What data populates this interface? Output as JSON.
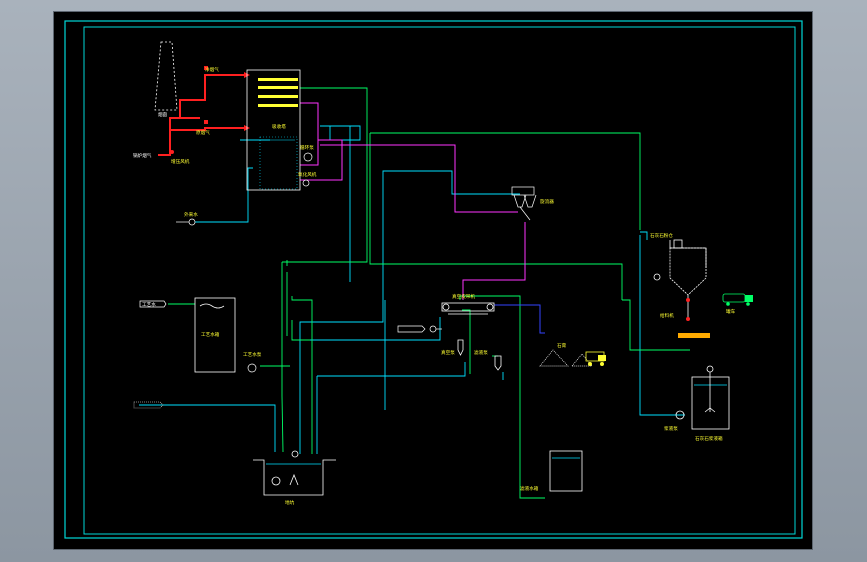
{
  "colors": {
    "background": "#000000",
    "frame": "#00d8d8",
    "flue_gas": "#ff2020",
    "water": "#00ff66",
    "slurry": "#00e0ff",
    "gypsum": "#ff33ff",
    "filtrate": "#3344ff",
    "equipment": "#ffffff",
    "label": "#ffff33"
  },
  "labels": {
    "chimney": "烟囱",
    "flue_gas_upper": "净烟气",
    "flue_gas_mid": "原烟气",
    "flue_gas_inlet": "锅炉烟气",
    "booster_fan": "增压风机",
    "absorber": "吸收塔",
    "circulation_pump": "循环泵",
    "oxidation_fan": "氧化风机",
    "cyclone": "旋流器",
    "process_water_tank": "工艺水箱",
    "process_water_pump": "工艺水泵",
    "process_water_in": "工艺水",
    "vacuum_filter": "真空皮带机",
    "vacuum_pump": "真空泵",
    "filtrate_pump": "滤液泵",
    "gypsum_truck": "石膏",
    "sump": "地坑",
    "external_water": "外来水",
    "filtrate_tank": "滤液水箱",
    "lime_silo": "石灰石粉仓",
    "tanker": "罐车",
    "slurry_tank": "石灰石浆液箱",
    "slurry_pump": "浆液泵",
    "feeder": "给料机"
  }
}
